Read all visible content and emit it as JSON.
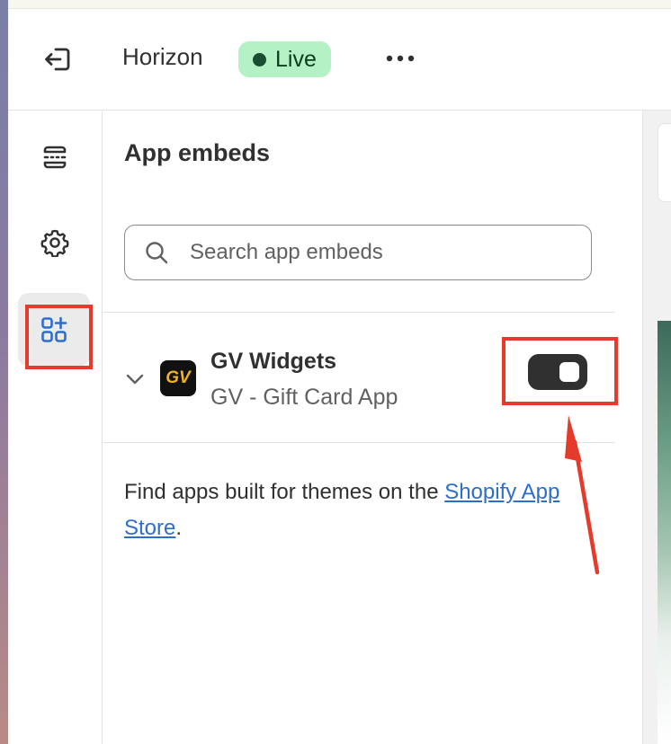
{
  "topbar": {
    "theme_name": "Horizon",
    "status_badge": "Live"
  },
  "panel": {
    "title": "App embeds",
    "search": {
      "placeholder": "Search app embeds",
      "value": ""
    },
    "app": {
      "logo_text": "GV",
      "name": "GV Widgets",
      "subtitle": "GV - Gift Card App",
      "enabled": true
    },
    "footer": {
      "text_before": "Find apps built for themes on the ",
      "link": "Shopify App Store",
      "text_after": "."
    }
  },
  "colors": {
    "live_badge_bg": "#b4f1c4",
    "toggle_on": "#303030",
    "link": "#2c6ecb",
    "annotation": "#e53b2c"
  },
  "icons": [
    "exit-icon",
    "more-icon",
    "sections-icon",
    "gear-icon",
    "apps-add-icon",
    "search-icon",
    "chevron-down-icon"
  ]
}
